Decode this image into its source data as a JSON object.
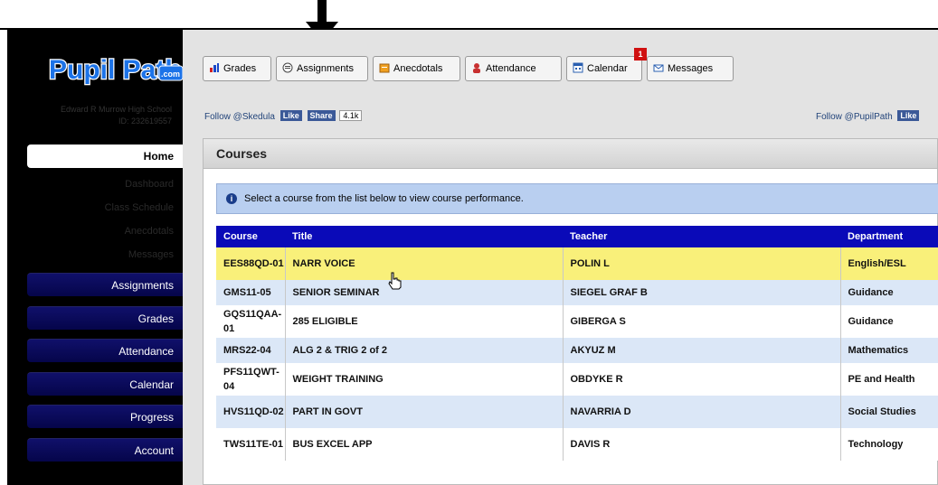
{
  "logo_text": "Pupil Path",
  "logo_suffix": ".com",
  "school": {
    "name": "Edward R Murrow High School",
    "id": "ID: 232619557"
  },
  "sidebar": {
    "home": "Home",
    "sublinks": [
      "Dashboard",
      "Class Schedule",
      "Anecdotals",
      "Messages"
    ],
    "buttons": [
      "Assignments",
      "Grades",
      "Attendance",
      "Calendar",
      "Progress",
      "Account"
    ]
  },
  "tabs": [
    {
      "label": "Grades",
      "icon": "bar-chart-icon"
    },
    {
      "label": "Assignments",
      "icon": "assignment-icon"
    },
    {
      "label": "Anecdotals",
      "icon": "note-icon"
    },
    {
      "label": "Attendance",
      "icon": "person-icon"
    },
    {
      "label": "Calendar",
      "icon": "calendar-icon"
    },
    {
      "label": "Messages",
      "icon": "envelope-icon"
    }
  ],
  "messages_badge": "1",
  "social": {
    "left_follow": "Follow @Skedula",
    "right_follow": "Follow @PupilPath",
    "like": "Like",
    "share": "Share",
    "share_count": "4.1k"
  },
  "courses": {
    "title": "Courses",
    "info": "Select a course from the list below to view course performance.",
    "headers": [
      "Course",
      "Title",
      "Teacher",
      "Department"
    ],
    "rows": [
      {
        "course": "EES88QD-01",
        "title": "NARR VOICE",
        "teacher": "POLIN L",
        "department": "English/ESL"
      },
      {
        "course": "GMS11-05",
        "title": "SENIOR SEMINAR",
        "teacher": "SIEGEL GRAF B",
        "department": "Guidance"
      },
      {
        "course": "GQS11QAA-01",
        "title": "285 ELIGIBLE",
        "teacher": "GIBERGA S",
        "department": "Guidance"
      },
      {
        "course": "MRS22-04",
        "title": "ALG 2 & TRIG 2 of 2",
        "teacher": "AKYUZ M",
        "department": "Mathematics"
      },
      {
        "course": "PFS11QWT-04",
        "title": "WEIGHT TRAINING",
        "teacher": "OBDYKE R",
        "department": "PE and Health"
      },
      {
        "course": "HVS11QD-02",
        "title": "PART IN GOVT",
        "teacher": "NAVARRIA D",
        "department": "Social Studies"
      },
      {
        "course": "TWS11TE-01",
        "title": "BUS EXCEL APP",
        "teacher": "DAVIS R",
        "department": "Technology"
      }
    ]
  }
}
